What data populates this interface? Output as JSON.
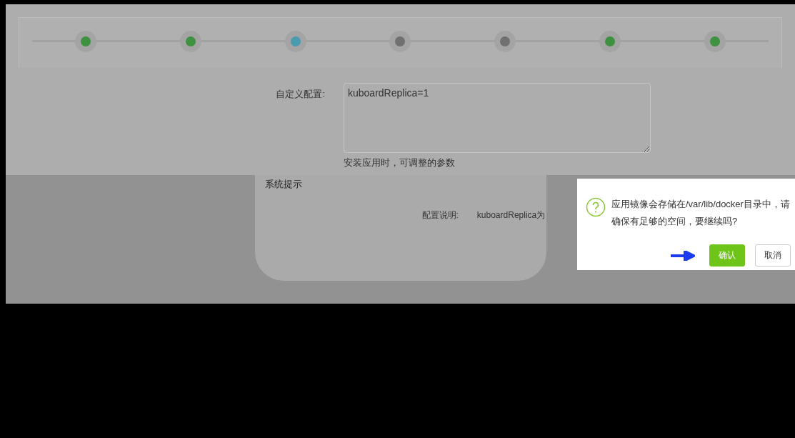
{
  "steps": [
    {
      "color": "#3f9142"
    },
    {
      "color": "#3f9142"
    },
    {
      "color": "#4a9ab0"
    },
    {
      "color": "#707070"
    },
    {
      "color": "#707070"
    },
    {
      "color": "#3f9142"
    },
    {
      "color": "#3f9142"
    }
  ],
  "form": {
    "label": "自定义配置:",
    "value": "kuboardReplica=1",
    "hint": "安装应用时，可调整的参数"
  },
  "dialog": {
    "title": "系统提示",
    "label": "配置说明:",
    "value": "kuboardReplica为"
  },
  "popconfirm": {
    "message": "应用镜像会存储在/var/lib/docker目录中，请确保有足够的空间，要继续吗?",
    "buttons": [
      {
        "label": "确认",
        "kind": "primary"
      },
      {
        "label": "取消",
        "kind": "default"
      }
    ]
  }
}
